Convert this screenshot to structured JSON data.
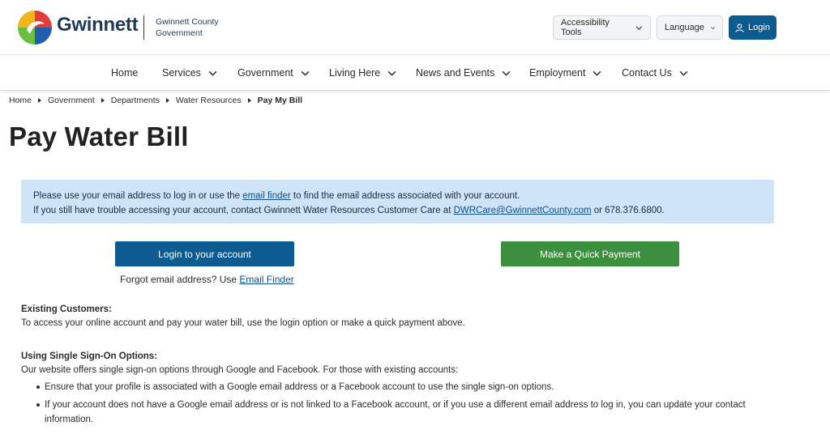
{
  "header": {
    "brand_name": "Gwinnett",
    "brand_sub_line1": "Gwinnett County",
    "brand_sub_line2": "Government",
    "accessibility_label": "Accessibility Tools",
    "language_label": "Language",
    "login_label": "Login",
    "colors": {
      "brand": "#1f3a5a",
      "primary": "#0d5c91"
    }
  },
  "nav": {
    "items": [
      {
        "label": "Home",
        "has_dropdown": false
      },
      {
        "label": "Services",
        "has_dropdown": true
      },
      {
        "label": "Government",
        "has_dropdown": true
      },
      {
        "label": "Living Here",
        "has_dropdown": true
      },
      {
        "label": "News and Events",
        "has_dropdown": true
      },
      {
        "label": "Employment",
        "has_dropdown": true
      },
      {
        "label": "Contact Us",
        "has_dropdown": true
      }
    ]
  },
  "breadcrumb": [
    "Home",
    "Government",
    "Departments",
    "Water Resources",
    "Pay My Bill"
  ],
  "page_title": "Pay Water Bill",
  "info": {
    "line1_prefix": "Please use your email address to log in or use the ",
    "line1_link": "email finder",
    "line1_suffix": " to find the email address associated with your account.",
    "line2_prefix": "If you still have trouble accessing your account, contact Gwinnett Water Resources Customer Care at ",
    "line2_link": "DWRCare@GwinnettCounty.com",
    "line2_suffix": " or 678.376.6800.",
    "bg_color": "#cfe4f7"
  },
  "actions": {
    "login_account": "Login to your account",
    "quick_payment": "Make a Quick Payment",
    "forgot_prefix": "Forgot email address? Use ",
    "forgot_link": "Email Finder",
    "green_color": "#3b8f3f"
  },
  "existing": {
    "heading": "Existing Customers:",
    "text": "To access your online account and pay your water bill, use the login option or make a quick payment above."
  },
  "sso": {
    "heading": "Using Single Sign-On Options:",
    "text": "Our website offers single sign-on options through Google and Facebook. For those with existing accounts:",
    "bullets": [
      "Ensure that your profile is associated with a Google email address or a Facebook account to use the single sign-on options.",
      "If your account does not have a Google email address or is not linked to a Facebook account, or if you use a different email address to log in, you can update your contact information."
    ]
  }
}
